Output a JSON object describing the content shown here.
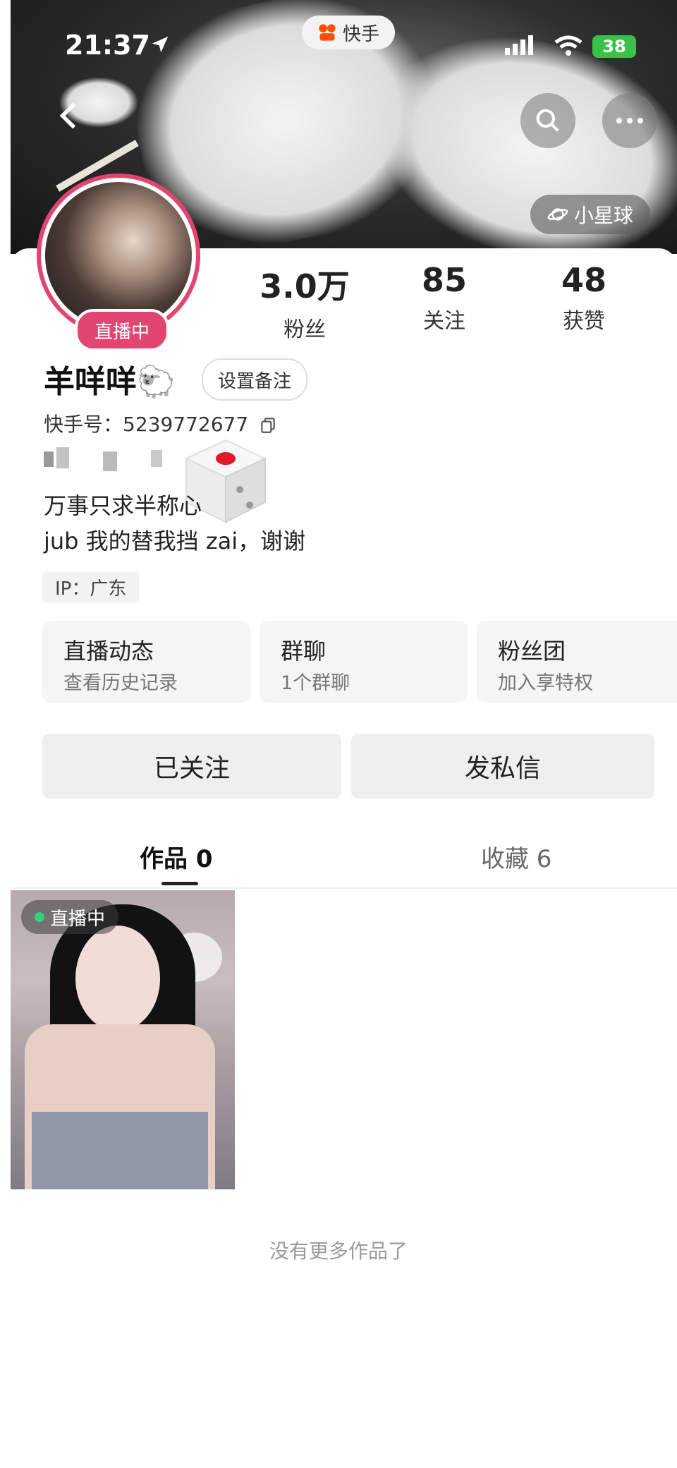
{
  "status_bar": {
    "time": "21:37",
    "battery": "38"
  },
  "header": {
    "app_name": "快手",
    "planet_label": "小星球"
  },
  "profile": {
    "live_badge": "直播中",
    "name": "羊咩咩",
    "name_emoji": "🐑",
    "remark_button": "设置备注",
    "kuaishou_id": "快手号：5239772677",
    "bio_line1": "万事只求半称心",
    "bio_line2": "jub 我的替我挡 zai，谢谢",
    "ip": "IP：广东"
  },
  "stats": [
    {
      "value": "3.0万",
      "label": "粉丝"
    },
    {
      "value": "85",
      "label": "关注"
    },
    {
      "value": "48",
      "label": "获赞"
    }
  ],
  "cards": [
    {
      "title": "直播动态",
      "subtitle": "查看历史记录"
    },
    {
      "title": "群聊",
      "subtitle": "1个群聊"
    },
    {
      "title": "粉丝团",
      "subtitle": "加入享特权"
    }
  ],
  "actions": {
    "followed": "已关注",
    "message": "发私信"
  },
  "tabs": [
    {
      "label": "作品 0",
      "active": true
    },
    {
      "label": "收藏 6",
      "active": false
    }
  ],
  "works": {
    "live_tag": "直播中",
    "no_more": "没有更多作品了"
  },
  "colors": {
    "accent_pink": "#e2456f",
    "live_green": "#31d27c"
  },
  "icons": [
    "back-icon",
    "search-icon",
    "more-icon",
    "planet-icon",
    "copy-icon",
    "location-arrow-icon",
    "signal-icon",
    "wifi-icon",
    "battery-icon",
    "dice-sticker-icon"
  ]
}
